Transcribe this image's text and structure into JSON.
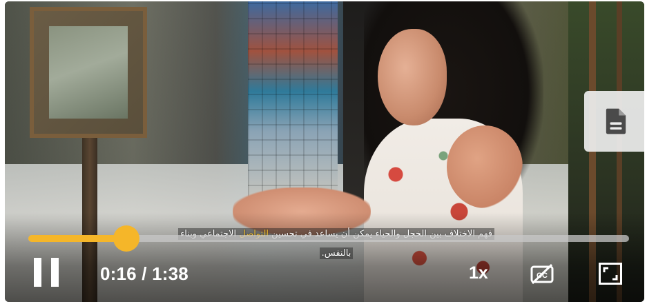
{
  "transcript_button": {
    "icon": "document-icon"
  },
  "caption": {
    "line1_before": "فهم الاختلاف بين الخجل والحياء يمكن أن يساعد في تحسين",
    "line1_highlight": "التواصل",
    "line1_after": "الاجتماعي وبناء",
    "line2": "بالنفس."
  },
  "progress": {
    "fraction": 0.163,
    "color": "#f5b629"
  },
  "controls": {
    "play_state_icon": "pause-icon",
    "time": "0:16 / 1:38",
    "speed": "1x",
    "captions_icon": "captions-off-icon",
    "fullscreen_icon": "fullscreen-icon"
  }
}
